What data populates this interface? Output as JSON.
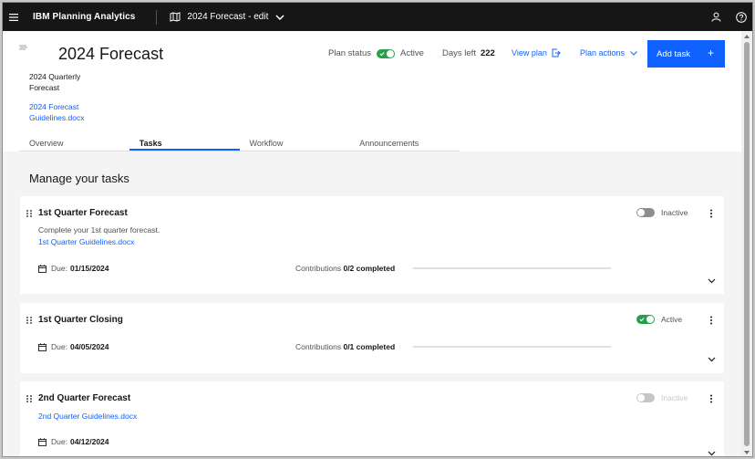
{
  "app": {
    "brand": "IBM Planning Analytics",
    "plan_title": "2024 Forecast - edit"
  },
  "header": {
    "title": "2024 Forecast",
    "subtitle": "2024 Quarterly Forecast",
    "doc_link": "2024 Forecast Guidelines.docx",
    "plan_status_label": "Plan status",
    "plan_status_value": "Active",
    "days_left_label": "Days left",
    "days_left_value": "222",
    "view_plan": "View plan",
    "plan_actions": "Plan actions",
    "add_task": "Add task",
    "add_task_plus": "+"
  },
  "tabs": [
    {
      "label": "Overview",
      "active": false
    },
    {
      "label": "Tasks",
      "active": true
    },
    {
      "label": "Workflow",
      "active": false
    },
    {
      "label": "Announcements",
      "active": false
    }
  ],
  "main": {
    "section_title": "Manage your tasks"
  },
  "tasks": [
    {
      "title": "1st Quarter Forecast",
      "description": "Complete your 1st quarter forecast.",
      "link": "1st Quarter Guidelines.docx",
      "status": "Inactive",
      "due_label": "Due:",
      "due_date": "01/15/2024",
      "contrib_label": "Contributions",
      "contrib_value": "0/2 completed",
      "progress": 0
    },
    {
      "title": "1st Quarter Closing",
      "status": "Active",
      "due_label": "Due:",
      "due_date": "04/05/2024",
      "contrib_label": "Contributions",
      "contrib_value": "0/1 completed",
      "progress": 0
    },
    {
      "title": "2nd Quarter Forecast",
      "link": "2nd Quarter Guidelines.docx",
      "status": "Inactive",
      "due_label": "Due:",
      "due_date": "04/12/2024"
    }
  ],
  "colors": {
    "accent": "#0f62fe",
    "active_toggle": "#24a148",
    "topbar": "#161616"
  }
}
